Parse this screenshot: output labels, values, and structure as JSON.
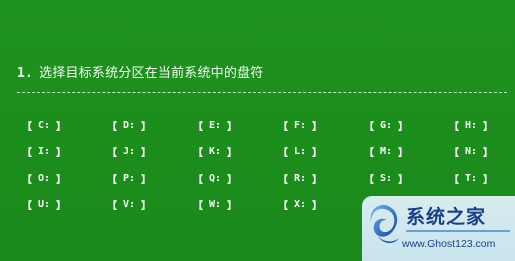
{
  "prompt": {
    "number": "1.",
    "text": "选择目标系统分区在当前系统中的盘符"
  },
  "drives": [
    [
      "C:",
      "D:",
      "E:",
      "F:",
      "G:",
      "H:"
    ],
    [
      "I:",
      "J:",
      "K:",
      "L:",
      "M:",
      "N:"
    ],
    [
      "O:",
      "P:",
      "Q:",
      "R:",
      "S:",
      "T:"
    ],
    [
      "U:",
      "V:",
      "W:",
      "X:",
      "",
      ""
    ]
  ],
  "brackets": {
    "left": "【",
    "right": "】"
  },
  "watermark": {
    "title": "系统之家",
    "url": "www.Ghost123.com"
  }
}
